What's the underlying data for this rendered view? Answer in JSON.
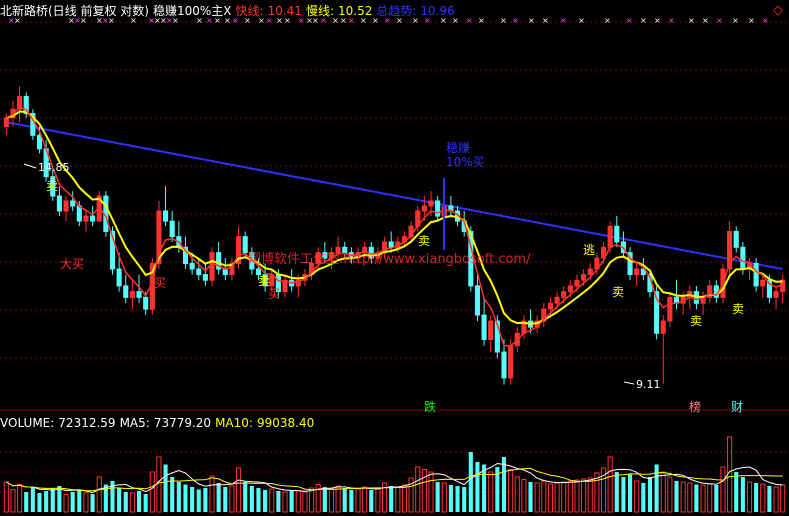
{
  "header": {
    "stock_title": "北新路桥(日线 前复权 对数)",
    "indicator_name": "稳赚100%主X",
    "fast_label": "快线:",
    "fast_value": "10.41",
    "slow_label": "慢线:",
    "slow_value": "10.52",
    "trend_label": "总趋势:",
    "trend_value": "10.96"
  },
  "volume_header": {
    "volume_label": "VOLUME:",
    "volume_value": "72312.59",
    "ma5_label": "MA5:",
    "ma5_value": "73779.20",
    "ma10_label": "MA10:",
    "ma10_value": "99038.40"
  },
  "annotations": {
    "high_price": "14.85",
    "low_price": "9.11",
    "big_buy": "大买",
    "sell": "卖",
    "buy": "买",
    "escape": "逃",
    "steady_buy_line1": "稳赚",
    "steady_buy_line2": "10%买",
    "watermark": "翔博软件工作室:http://www.xiangbosoft.com/",
    "drop_tag": "跌",
    "rank_tag": "榜",
    "finance_tag": "财",
    "corner_symbol": "◇"
  },
  "colors": {
    "up": "#ff3232",
    "down": "#54fcfc",
    "fast_line": "#ff3232",
    "slow_line": "#ffff00",
    "trend_line": "#3030ff",
    "grid": "#800000",
    "ma5_line": "#ffffff",
    "ma10_line": "#ffff00"
  },
  "chart_data": {
    "type": "candlestick",
    "price_range": [
      8.8,
      16.5
    ],
    "price_axis": "log",
    "candles": [
      [
        13.9,
        14.2,
        13.7,
        14.1
      ],
      [
        14.1,
        14.5,
        13.9,
        14.3
      ],
      [
        14.3,
        14.85,
        14.0,
        14.6
      ],
      [
        14.6,
        14.7,
        14.1,
        14.2
      ],
      [
        14.2,
        14.3,
        13.6,
        13.7
      ],
      [
        13.7,
        13.9,
        13.3,
        13.4
      ],
      [
        13.4,
        13.6,
        12.7,
        12.8
      ],
      [
        12.8,
        13.0,
        12.3,
        12.4
      ],
      [
        12.4,
        12.6,
        12.0,
        12.1
      ],
      [
        12.1,
        12.4,
        11.9,
        12.3
      ],
      [
        12.3,
        12.5,
        12.1,
        12.2
      ],
      [
        12.2,
        12.3,
        11.8,
        11.9
      ],
      [
        11.9,
        12.1,
        11.7,
        12.0
      ],
      [
        12.0,
        12.2,
        11.8,
        11.9
      ],
      [
        11.9,
        12.5,
        11.9,
        12.4
      ],
      [
        12.4,
        12.5,
        11.6,
        11.7
      ],
      [
        11.7,
        11.8,
        10.9,
        11.0
      ],
      [
        11.0,
        11.3,
        10.6,
        10.7
      ],
      [
        10.7,
        10.9,
        10.4,
        10.5
      ],
      [
        10.5,
        10.8,
        10.3,
        10.6
      ],
      [
        10.6,
        10.9,
        10.4,
        10.5
      ],
      [
        10.5,
        10.6,
        10.2,
        10.3
      ],
      [
        10.3,
        11.2,
        10.2,
        11.1
      ],
      [
        11.1,
        12.3,
        11.0,
        12.1
      ],
      [
        12.1,
        12.6,
        11.8,
        11.9
      ],
      [
        11.9,
        12.1,
        11.5,
        11.6
      ],
      [
        11.6,
        11.9,
        11.3,
        11.4
      ],
      [
        11.4,
        11.6,
        11.0,
        11.1
      ],
      [
        11.1,
        11.3,
        10.9,
        11.0
      ],
      [
        11.0,
        11.2,
        10.8,
        10.9
      ],
      [
        10.9,
        11.1,
        10.7,
        10.8
      ],
      [
        10.8,
        11.4,
        10.7,
        11.3
      ],
      [
        11.3,
        11.5,
        10.9,
        11.0
      ],
      [
        11.0,
        11.2,
        10.8,
        10.9
      ],
      [
        10.9,
        11.2,
        10.8,
        11.1
      ],
      [
        11.1,
        11.8,
        11.0,
        11.6
      ],
      [
        11.6,
        11.7,
        11.2,
        11.3
      ],
      [
        11.3,
        11.4,
        10.9,
        11.0
      ],
      [
        11.0,
        11.2,
        10.8,
        10.9
      ],
      [
        10.9,
        11.1,
        10.6,
        10.7
      ],
      [
        10.7,
        11.0,
        10.6,
        10.9
      ],
      [
        10.9,
        11.0,
        10.5,
        10.6
      ],
      [
        10.6,
        10.9,
        10.5,
        10.8
      ],
      [
        10.8,
        11.0,
        10.6,
        10.7
      ],
      [
        10.7,
        10.9,
        10.5,
        10.8
      ],
      [
        10.8,
        11.0,
        10.7,
        10.9
      ],
      [
        10.9,
        11.2,
        10.8,
        11.1
      ],
      [
        11.1,
        11.4,
        11.0,
        11.3
      ],
      [
        11.3,
        11.5,
        11.1,
        11.2
      ],
      [
        11.2,
        11.4,
        11.0,
        11.3
      ],
      [
        11.3,
        11.6,
        11.2,
        11.4
      ],
      [
        11.4,
        11.5,
        11.2,
        11.3
      ],
      [
        11.3,
        11.4,
        11.1,
        11.2
      ],
      [
        11.2,
        11.4,
        11.1,
        11.3
      ],
      [
        11.3,
        11.5,
        11.2,
        11.4
      ],
      [
        11.4,
        11.5,
        11.1,
        11.2
      ],
      [
        11.2,
        11.4,
        11.1,
        11.3
      ],
      [
        11.3,
        11.6,
        11.2,
        11.5
      ],
      [
        11.5,
        11.7,
        11.3,
        11.4
      ],
      [
        11.4,
        11.6,
        11.3,
        11.5
      ],
      [
        11.5,
        11.7,
        11.4,
        11.6
      ],
      [
        11.6,
        11.9,
        11.5,
        11.8
      ],
      [
        11.8,
        12.2,
        11.7,
        12.1
      ],
      [
        12.1,
        12.4,
        11.9,
        12.2
      ],
      [
        12.2,
        12.5,
        12.0,
        12.3
      ],
      [
        12.3,
        12.4,
        11.9,
        12.0
      ],
      [
        12.0,
        12.3,
        11.9,
        12.2
      ],
      [
        12.2,
        12.4,
        12.0,
        12.1
      ],
      [
        12.1,
        12.2,
        11.8,
        11.9
      ],
      [
        11.9,
        12.1,
        11.6,
        11.7
      ],
      [
        11.7,
        11.8,
        10.6,
        10.7
      ],
      [
        10.7,
        10.9,
        10.1,
        10.2
      ],
      [
        10.2,
        10.5,
        9.7,
        9.8
      ],
      [
        9.8,
        10.2,
        9.6,
        10.1
      ],
      [
        10.1,
        10.2,
        9.5,
        9.6
      ],
      [
        9.6,
        9.8,
        9.1,
        9.2
      ],
      [
        9.2,
        9.8,
        9.1,
        9.7
      ],
      [
        9.7,
        10.0,
        9.6,
        9.9
      ],
      [
        9.9,
        10.2,
        9.8,
        10.1
      ],
      [
        10.1,
        10.3,
        9.9,
        10.0
      ],
      [
        10.0,
        10.2,
        9.9,
        10.1
      ],
      [
        10.1,
        10.4,
        10.0,
        10.3
      ],
      [
        10.3,
        10.5,
        10.2,
        10.4
      ],
      [
        10.4,
        10.6,
        10.3,
        10.5
      ],
      [
        10.5,
        10.7,
        10.4,
        10.6
      ],
      [
        10.6,
        10.8,
        10.5,
        10.7
      ],
      [
        10.7,
        10.9,
        10.6,
        10.8
      ],
      [
        10.8,
        11.0,
        10.7,
        10.9
      ],
      [
        10.9,
        11.1,
        10.8,
        11.0
      ],
      [
        11.0,
        11.3,
        10.9,
        11.2
      ],
      [
        11.2,
        11.5,
        11.1,
        11.4
      ],
      [
        11.4,
        11.9,
        11.3,
        11.8
      ],
      [
        11.8,
        12.0,
        11.4,
        11.5
      ],
      [
        11.5,
        11.7,
        11.2,
        11.3
      ],
      [
        11.3,
        11.4,
        10.8,
        10.9
      ],
      [
        10.9,
        11.1,
        10.7,
        11.0
      ],
      [
        11.0,
        11.2,
        10.8,
        10.9
      ],
      [
        10.9,
        11.0,
        10.5,
        10.6
      ],
      [
        10.6,
        10.7,
        9.8,
        9.9
      ],
      [
        9.9,
        10.2,
        9.11,
        10.1
      ],
      [
        10.1,
        10.6,
        10.0,
        10.5
      ],
      [
        10.5,
        10.8,
        10.3,
        10.4
      ],
      [
        10.4,
        10.6,
        10.2,
        10.5
      ],
      [
        10.5,
        10.7,
        10.3,
        10.6
      ],
      [
        10.6,
        10.7,
        10.3,
        10.4
      ],
      [
        10.4,
        10.6,
        10.2,
        10.5
      ],
      [
        10.5,
        10.8,
        10.4,
        10.7
      ],
      [
        10.7,
        10.8,
        10.4,
        10.5
      ],
      [
        10.5,
        11.1,
        10.4,
        11.0
      ],
      [
        11.0,
        11.9,
        10.9,
        11.7
      ],
      [
        11.7,
        11.8,
        11.3,
        11.4
      ],
      [
        11.4,
        11.5,
        10.9,
        11.0
      ],
      [
        11.0,
        11.2,
        10.8,
        11.1
      ],
      [
        11.1,
        11.2,
        10.6,
        10.7
      ],
      [
        10.7,
        10.9,
        10.5,
        10.8
      ],
      [
        10.8,
        10.9,
        10.4,
        10.5
      ],
      [
        10.5,
        10.7,
        10.3,
        10.6
      ],
      [
        10.6,
        10.9,
        10.4,
        10.8
      ]
    ],
    "volume": [
      60,
      45,
      55,
      40,
      50,
      38,
      42,
      48,
      52,
      35,
      40,
      45,
      38,
      36,
      70,
      55,
      62,
      48,
      40,
      38,
      42,
      36,
      80,
      110,
      95,
      70,
      60,
      55,
      50,
      45,
      48,
      72,
      58,
      50,
      52,
      88,
      60,
      52,
      48,
      44,
      46,
      42,
      40,
      44,
      42,
      40,
      48,
      55,
      50,
      46,
      52,
      48,
      44,
      46,
      50,
      44,
      46,
      58,
      52,
      50,
      54,
      68,
      90,
      85,
      80,
      60,
      58,
      54,
      52,
      50,
      120,
      100,
      95,
      80,
      90,
      110,
      85,
      70,
      65,
      60,
      58,
      62,
      56,
      58,
      60,
      62,
      64,
      66,
      68,
      78,
      88,
      110,
      80,
      70,
      75,
      62,
      58,
      70,
      95,
      80,
      70,
      62,
      60,
      58,
      55,
      54,
      56,
      54,
      90,
      150,
      80,
      70,
      60,
      58,
      56,
      52,
      50,
      54
    ],
    "volume_range": [
      0,
      160
    ]
  }
}
